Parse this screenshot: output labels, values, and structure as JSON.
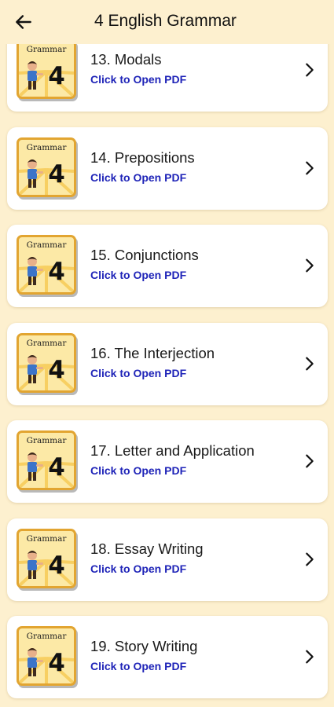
{
  "app_bar": {
    "title": "4 English Grammar",
    "back_icon": "arrow-left-icon"
  },
  "thumbnail": {
    "label": "Grammar",
    "number": "4",
    "border_color": "#E2A531",
    "background_color": "#FCE9A6"
  },
  "items": [
    {
      "title": "13. Modals",
      "link": "Click to Open PDF"
    },
    {
      "title": "14. Prepositions",
      "link": "Click to Open PDF"
    },
    {
      "title": "15. Conjunctions",
      "link": "Click to Open PDF"
    },
    {
      "title": "16. The Interjection",
      "link": "Click to Open PDF"
    },
    {
      "title": "17. Letter and Application",
      "link": "Click to Open PDF"
    },
    {
      "title": "18. Essay Writing",
      "link": "Click to Open PDF"
    },
    {
      "title": "19. Story Writing",
      "link": "Click to Open PDF"
    }
  ],
  "colors": {
    "background": "#FDF0CF",
    "link": "#1F24B8",
    "card": "#FFFFFF"
  }
}
